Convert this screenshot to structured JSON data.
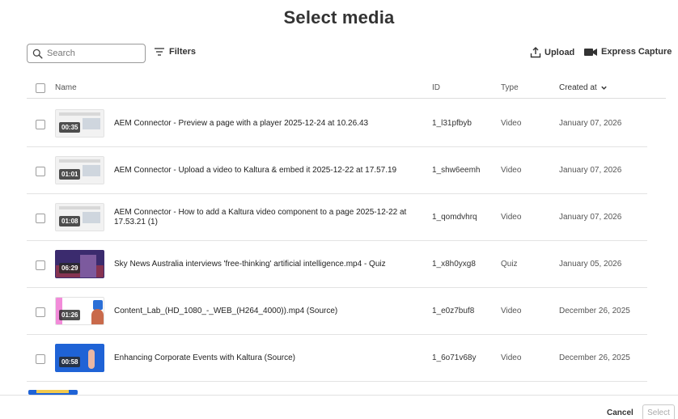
{
  "dialog": {
    "title": "Select media"
  },
  "toolbar": {
    "search_placeholder": "Search",
    "filters_label": "Filters",
    "upload_label": "Upload",
    "express_label": "Express Capture"
  },
  "table": {
    "columns": {
      "name": "Name",
      "id": "ID",
      "type": "Type",
      "created": "Created at"
    },
    "sort": {
      "column": "Created at",
      "direction": "descending"
    },
    "rows": [
      {
        "duration": "00:35",
        "name": "AEM Connector - Preview a page with a player 2025-12-24 at 10.26.43",
        "id": "1_l31pfbyb",
        "type": "Video",
        "created": "January 07, 2026"
      },
      {
        "duration": "01:01",
        "name": "AEM Connector - Upload a video to Kaltura & embed it 2025-12-22 at 17.57.19",
        "id": "1_shw6eemh",
        "type": "Video",
        "created": "January 07, 2026"
      },
      {
        "duration": "01:08",
        "name": "AEM Connector - How to add a Kaltura video component to a page 2025-12-22 at 17.53.21 (1)",
        "id": "1_qomdvhrq",
        "type": "Video",
        "created": "January 07, 2026"
      },
      {
        "duration": "06:29",
        "name": "Sky News Australia interviews 'free-thinking' artificial intelligence.mp4 - Quiz",
        "id": "1_x8h0yxg8",
        "type": "Quiz",
        "created": "January 05, 2026"
      },
      {
        "duration": "01:26",
        "name": "Content_Lab_(HD_1080_-_WEB_(H264_4000)).mp4 (Source)",
        "id": "1_e0z7buf8",
        "type": "Video",
        "created": "December 26, 2025"
      },
      {
        "duration": "00:58",
        "name": "Enhancing Corporate Events with Kaltura (Source)",
        "id": "1_6o71v68y",
        "type": "Video",
        "created": "December 26, 2025"
      }
    ]
  },
  "footer": {
    "cancel_label": "Cancel",
    "select_label": "Select"
  },
  "colors": {
    "text": "#333333",
    "border": "#dcdcdc",
    "select_disabled_text": "#aaaaaa"
  }
}
